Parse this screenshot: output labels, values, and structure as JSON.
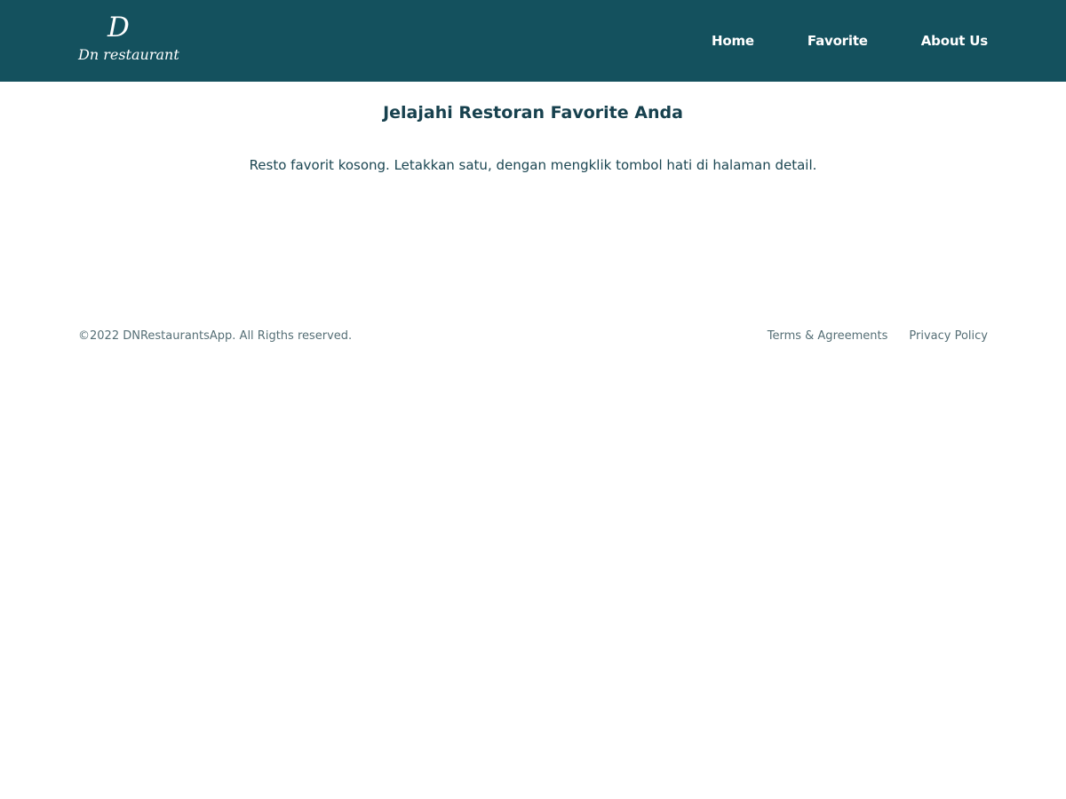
{
  "header": {
    "logo": {
      "mark": "D",
      "wordmark": "Dn restaurant"
    },
    "nav": [
      {
        "label": "Home"
      },
      {
        "label": "Favorite"
      },
      {
        "label": "About Us"
      }
    ]
  },
  "main": {
    "title": "Jelajahi Restoran Favorite Anda",
    "empty_message": "Resto favorit kosong. Letakkan satu, dengan mengklik tombol hati di halaman detail."
  },
  "footer": {
    "copyright": "©2022 DNRestaurantsApp. All Rigths reserved.",
    "links": [
      {
        "label": "Terms & Agreements"
      },
      {
        "label": "Privacy Policy"
      }
    ]
  },
  "colors": {
    "header_background": "#14515e",
    "heading_text": "#17414e",
    "body_text": "#1b4652",
    "footer_text": "#566f76",
    "page_background": "#ffffff"
  }
}
